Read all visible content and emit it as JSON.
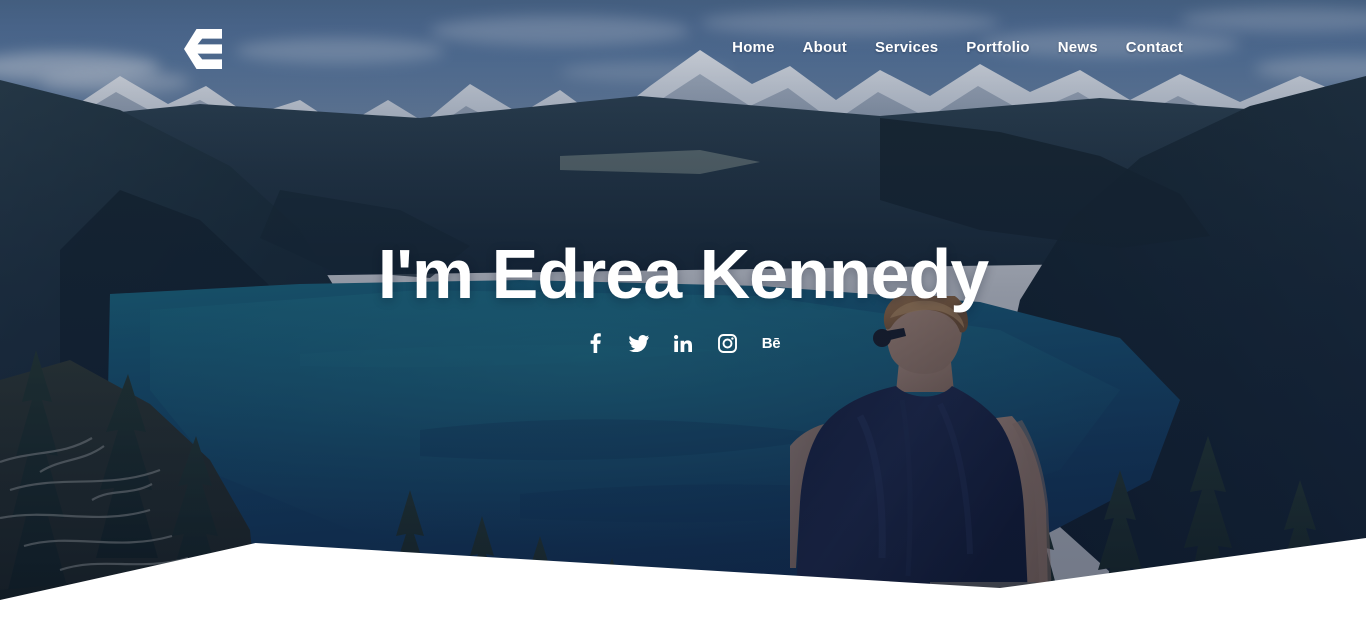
{
  "site": {
    "logo_icon": "chevron-e-logo",
    "logo_alt": "E"
  },
  "nav": {
    "items": [
      {
        "label": "Home",
        "name": "nav-item-home"
      },
      {
        "label": "About",
        "name": "nav-item-about"
      },
      {
        "label": "Services",
        "name": "nav-item-services"
      },
      {
        "label": "Portfolio",
        "name": "nav-item-portfolio"
      },
      {
        "label": "News",
        "name": "nav-item-news"
      },
      {
        "label": "Contact",
        "name": "nav-item-contact"
      }
    ]
  },
  "hero": {
    "title": "I'm Edrea Kennedy",
    "background_description": "Aerial photo of an alpine turquoise lake surrounded by snow-capped mountains and conifer forest, with a man seen from behind at the right",
    "overlay_color": "#0b1732",
    "text_color": "#ffffff",
    "socials": [
      {
        "name": "facebook-icon",
        "label": "f",
        "icon": "facebook"
      },
      {
        "name": "twitter-icon",
        "label": "",
        "icon": "twitter"
      },
      {
        "name": "linkedin-icon",
        "label": "in",
        "icon": "linkedin"
      },
      {
        "name": "instagram-icon",
        "label": "",
        "icon": "instagram"
      },
      {
        "name": "behance-icon",
        "label": "Bē",
        "icon": "behance"
      }
    ]
  },
  "footer_shape": {
    "name": "angled-white-divider",
    "color": "#ffffff"
  }
}
